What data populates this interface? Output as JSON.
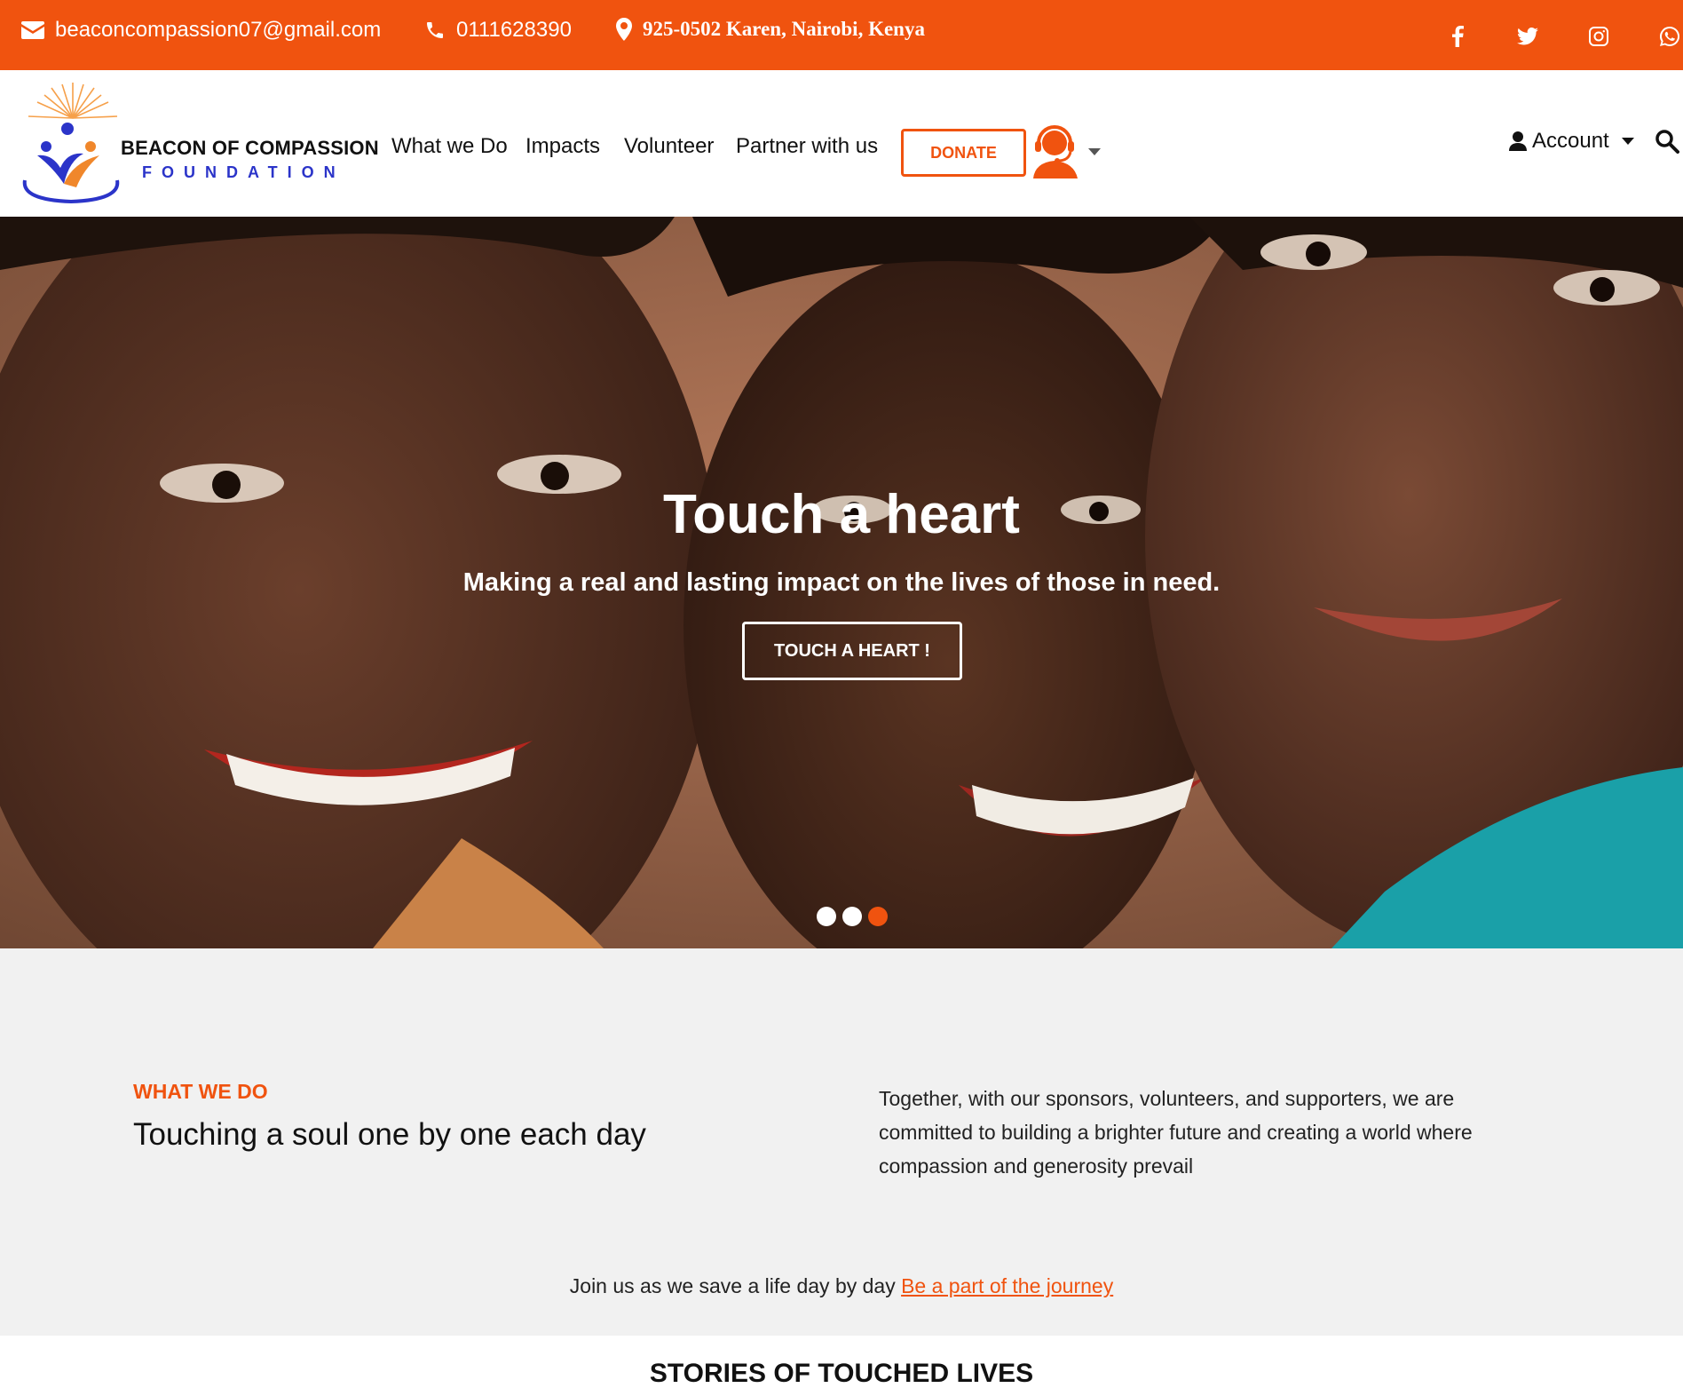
{
  "topbar": {
    "email": "beaconcompassion07@gmail.com",
    "phone": "0111628390",
    "address": "925-0502 Karen, Nairobi, Kenya",
    "social": [
      "facebook-icon",
      "twitter-icon",
      "instagram-icon",
      "whatsapp-icon"
    ]
  },
  "brand": {
    "name": "BEACON OF COMPASSION",
    "sub": "FOUNDATION"
  },
  "nav": {
    "links": [
      "What we Do",
      "Impacts",
      "Volunteer",
      "Partner with us"
    ],
    "donate": "DONATE",
    "account": "Account"
  },
  "hero": {
    "title": "Touch a heart",
    "subtitle": "Making a real and lasting impact on the lives of those in need.",
    "button": "TOUCH A HEART !",
    "slides": 3,
    "active_slide": 3
  },
  "what_we_do": {
    "kicker": "WHAT WE DO",
    "title": "Touching a soul one by one each day",
    "text": "Together, with our sponsors, volunteers, and supporters, we are committed to building a brighter future and creating a world where compassion and generosity prevail",
    "join_text": "Join us as we save a life day by day",
    "join_link": "Be a part of the journey"
  },
  "stories": {
    "title": "STORIES OF TOUCHED LIVES"
  },
  "colors": {
    "accent": "#f0530f",
    "brand_blue": "#2b34c9",
    "section_bg": "#f1f1f1"
  }
}
